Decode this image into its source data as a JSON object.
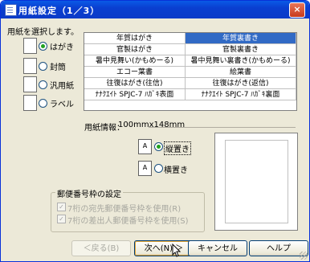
{
  "window": {
    "title": "用紙設定（1／3）",
    "close_symbol": "×"
  },
  "paper_select": {
    "heading": "用紙を選択します。",
    "options": [
      {
        "label": "はがき",
        "selected": true
      },
      {
        "label": "封筒",
        "selected": false
      },
      {
        "label": "汎用紙",
        "selected": false
      },
      {
        "label": "ラベル",
        "selected": false
      }
    ]
  },
  "paper_grid": {
    "rows": [
      [
        "年賀はがき",
        "年賀裏書き"
      ],
      [
        "官製はがき",
        "官製裏書き"
      ],
      [
        "暑中見舞い(かもめーる)",
        "暑中見舞い裏書き(かもめーる)"
      ],
      [
        "エコー葉書",
        "絵葉書"
      ],
      [
        "往復はがき(往信)",
        "往復はがき(返信)"
      ],
      [
        "ﾅﾅｸｴｲﾄ SPJC-7 ﾊｶﾞｷ表面",
        "ﾅﾅｸｴｲﾄ SPJC-7 ﾊｶﾞｷ裏面"
      ]
    ],
    "selected_row": 0,
    "selected_col": 1
  },
  "paper_info": {
    "label": "用紙情報：",
    "value": "100mmx148mm"
  },
  "orientation": {
    "options": [
      {
        "label": "縦置き",
        "selected": true
      },
      {
        "label": "横置き",
        "selected": false
      }
    ]
  },
  "postal_code": {
    "title": "郵便番号枠の設定",
    "options": [
      "7桁の宛先郵便番号枠を使用(R)",
      "7桁の差出人郵便番号枠を使用(S)"
    ]
  },
  "buttons": {
    "back": "＜戻る(B)",
    "next": "次へ(N) ＞",
    "cancel": "キャンセル",
    "help": "ヘルプ"
  }
}
